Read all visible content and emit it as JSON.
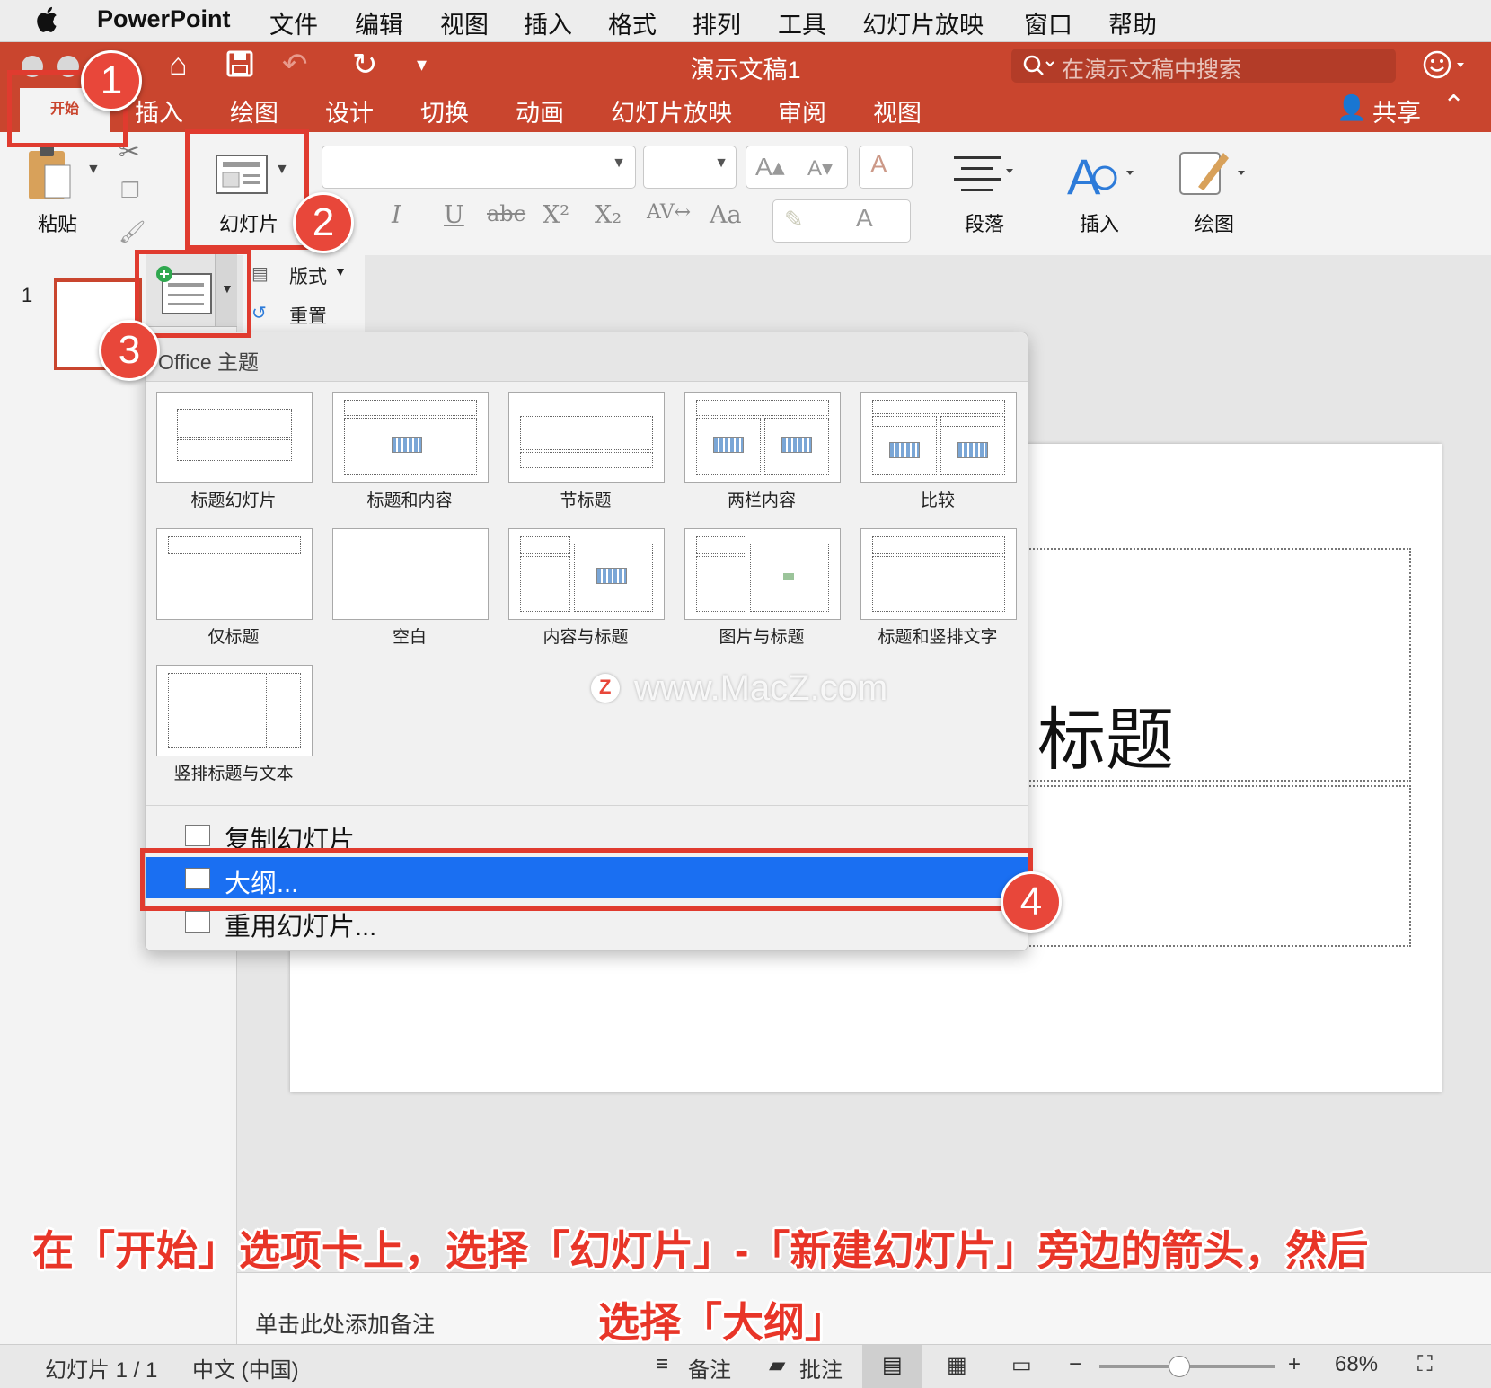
{
  "menubar": {
    "app": "PowerPoint",
    "items": [
      "文件",
      "编辑",
      "视图",
      "插入",
      "格式",
      "排列",
      "工具",
      "幻灯片放映",
      "窗口",
      "帮助"
    ]
  },
  "window": {
    "title": "演示文稿1",
    "search_placeholder": "在演示文稿中搜索"
  },
  "tabs": [
    "开始",
    "插入",
    "绘图",
    "设计",
    "切换",
    "动画",
    "幻灯片放映",
    "审阅",
    "视图"
  ],
  "share_label": "共享",
  "ribbon": {
    "paste": "粘贴",
    "slides": "幻灯片",
    "paragraph": "段落",
    "insert": "插入",
    "draw": "绘图",
    "layout": "版式",
    "reset": "重置"
  },
  "thumbnail_number": "1",
  "dropdown": {
    "theme_header": "Office 主题",
    "layouts": [
      "标题幻灯片",
      "标题和内容",
      "节标题",
      "两栏内容",
      "比较",
      "仅标题",
      "空白",
      "内容与标题",
      "图片与标题",
      "标题和竖排文字",
      "竖排标题与文本"
    ],
    "menu": [
      "复制幻灯片",
      "大纲...",
      "重用幻灯片..."
    ],
    "selected_index": 1
  },
  "slide": {
    "title_visible": "标题"
  },
  "watermark": "www.MacZ.com",
  "notes_placeholder": "单击此处添加备注",
  "status": {
    "slide": "幻灯片 1 / 1",
    "language": "中文 (中国)",
    "notes": "备注",
    "comments": "批注",
    "zoom": "68%"
  },
  "zoom_level": 0.68,
  "callouts": [
    "1",
    "2",
    "3",
    "4"
  ],
  "caption": {
    "line1": "在「开始」选项卡上，选择「幻灯片」-「新建幻灯片」旁边的箭头，然后",
    "line2": "选择「大纲」"
  },
  "colors": {
    "ribbon": "#c9452e",
    "selection": "#1a6ff2",
    "callout": "#e8473a"
  }
}
